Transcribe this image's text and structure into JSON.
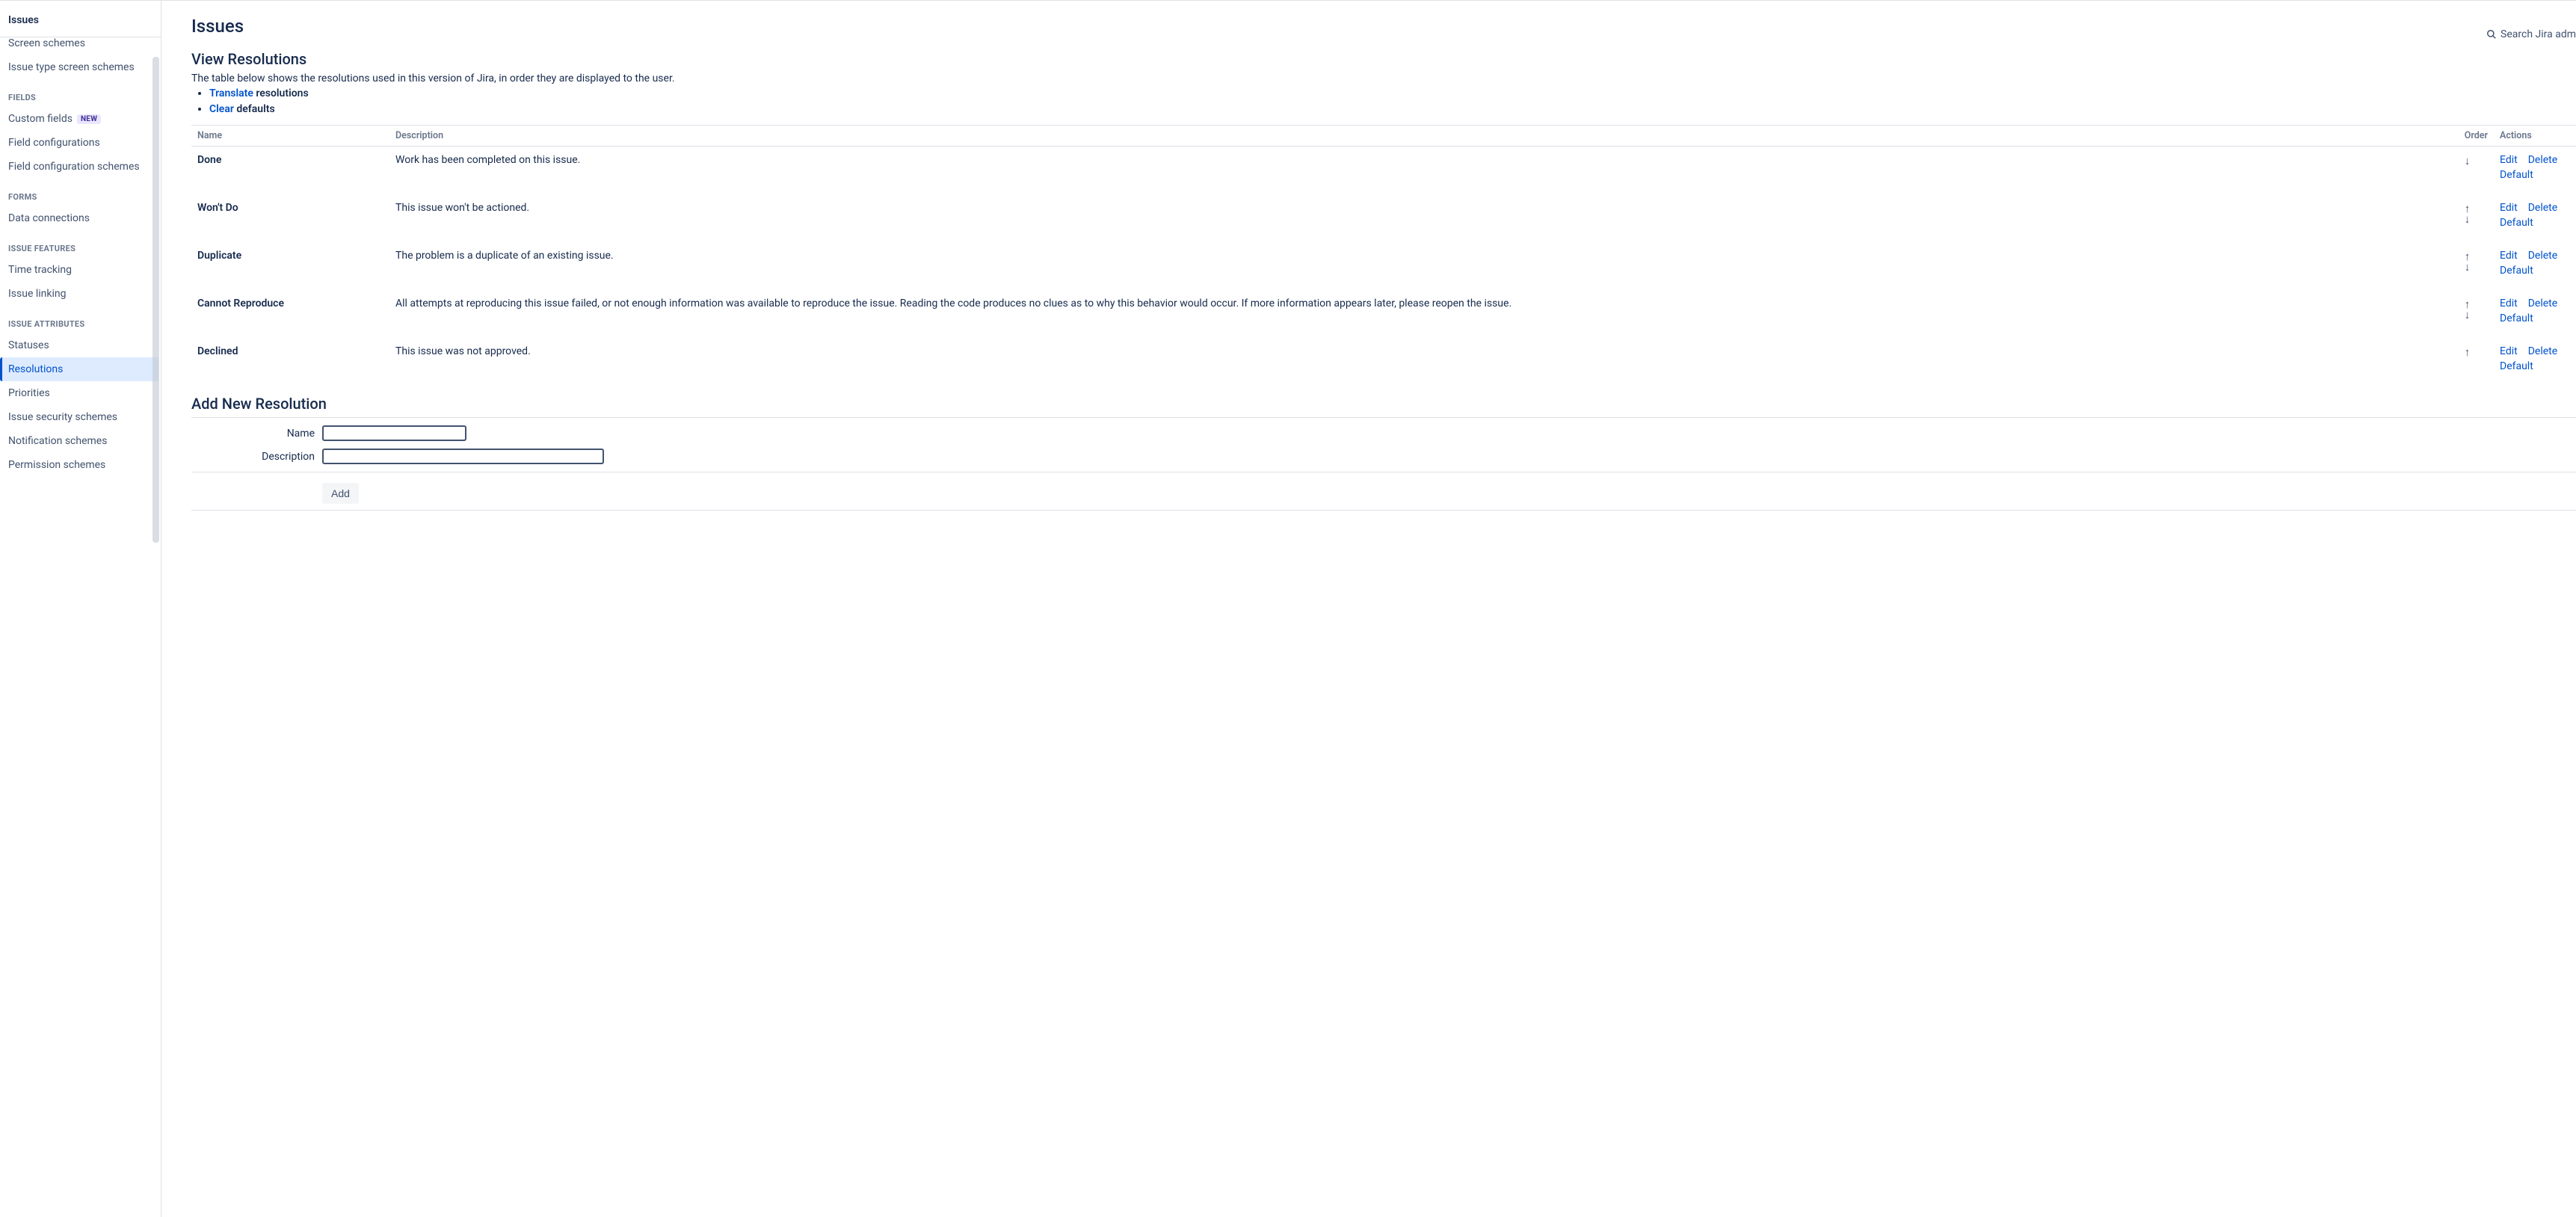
{
  "sidebar": {
    "title": "Issues",
    "pre_items": [
      {
        "label": "Screen schemes"
      },
      {
        "label": "Issue type screen schemes"
      }
    ],
    "groups": [
      {
        "title": "FIELDS",
        "items": [
          {
            "label": "Custom fields",
            "new": true
          },
          {
            "label": "Field configurations"
          },
          {
            "label": "Field configuration schemes"
          }
        ]
      },
      {
        "title": "FORMS",
        "items": [
          {
            "label": "Data connections"
          }
        ]
      },
      {
        "title": "ISSUE FEATURES",
        "items": [
          {
            "label": "Time tracking"
          },
          {
            "label": "Issue linking"
          }
        ]
      },
      {
        "title": "ISSUE ATTRIBUTES",
        "items": [
          {
            "label": "Statuses"
          },
          {
            "label": "Resolutions",
            "active": true
          },
          {
            "label": "Priorities"
          },
          {
            "label": "Issue security schemes"
          },
          {
            "label": "Notification schemes"
          },
          {
            "label": "Permission schemes"
          }
        ]
      }
    ],
    "new_badge": "NEW"
  },
  "header": {
    "page_title": "Issues",
    "search_label": "Search Jira adm"
  },
  "view": {
    "title": "View Resolutions",
    "intro": "The table below shows the resolutions used in this version of Jira, in order they are displayed to the user.",
    "translate_link": "Translate",
    "translate_rest": " resolutions",
    "clear_link": "Clear",
    "clear_rest": "defaults"
  },
  "table": {
    "headers": {
      "name": "Name",
      "description": "Description",
      "order": "Order",
      "actions": "Actions"
    },
    "action_labels": {
      "edit": "Edit",
      "delete": "Delete",
      "default": "Default"
    },
    "rows": [
      {
        "name": "Done",
        "desc": "Work has been completed on this issue.",
        "up": false,
        "down": true
      },
      {
        "name": "Won't Do",
        "desc": "This issue won't be actioned.",
        "up": true,
        "down": true
      },
      {
        "name": "Duplicate",
        "desc": "The problem is a duplicate of an existing issue.",
        "up": true,
        "down": true
      },
      {
        "name": "Cannot Reproduce",
        "desc": "All attempts at reproducing this issue failed, or not enough information was available to reproduce the issue. Reading the code produces no clues as to why this behavior would occur. If more information appears later, please reopen the issue.",
        "up": true,
        "down": true
      },
      {
        "name": "Declined",
        "desc": "This issue was not approved.",
        "up": true,
        "down": false
      }
    ]
  },
  "add_form": {
    "title": "Add New Resolution",
    "name_label": "Name",
    "desc_label": "Description",
    "button": "Add"
  }
}
